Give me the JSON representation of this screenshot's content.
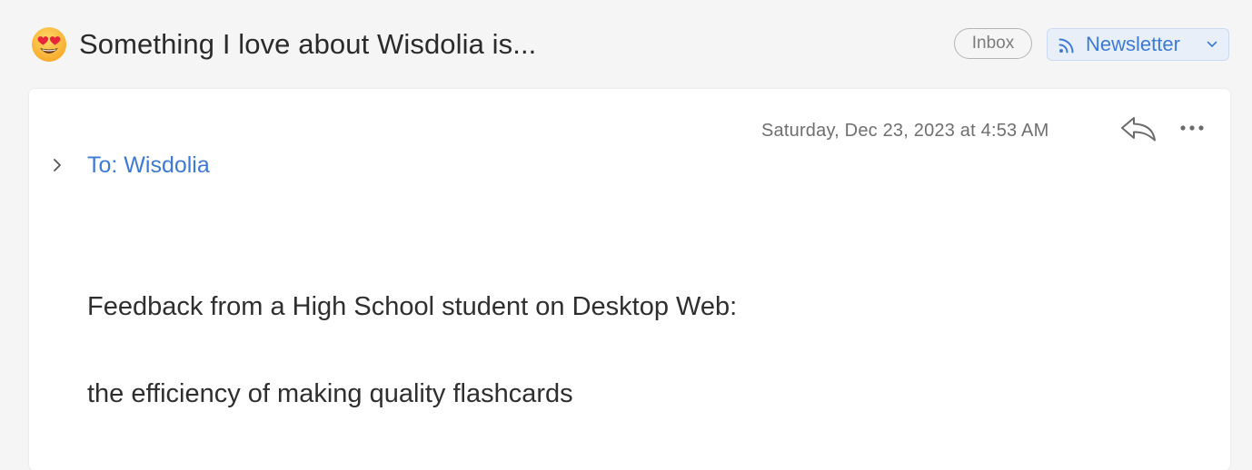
{
  "subject": {
    "emoji_icon": "heart-eyes-emoji",
    "title": "Something I love about Wisdolia is..."
  },
  "labels": {
    "inbox": "Inbox",
    "newsletter": "Newsletter",
    "newsletter_icon": "rss-icon"
  },
  "message": {
    "date": "Saturday, Dec 23, 2023 at 4:53 AM",
    "to": "To: Wisdolia",
    "body": [
      "Feedback from a High School student on Desktop Web:",
      "the efficiency of making quality flashcards"
    ]
  },
  "colors": {
    "background": "#f5f5f5",
    "accent": "#3d7ad6",
    "card": "#ffffff"
  }
}
